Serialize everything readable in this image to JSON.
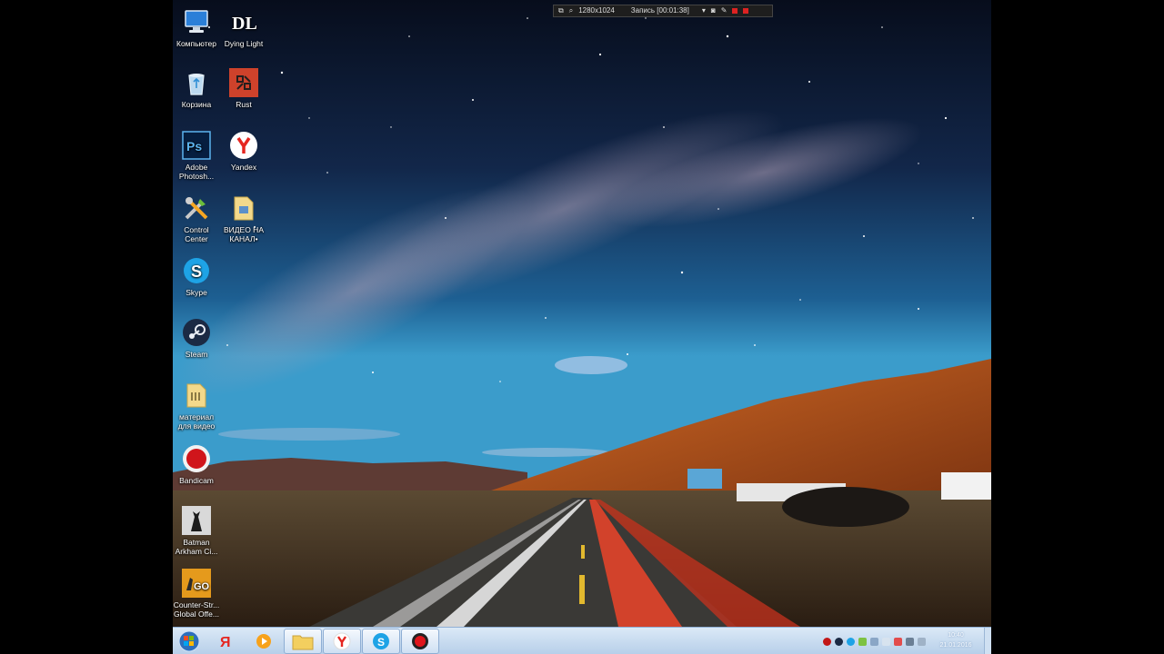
{
  "desktop_icons": [
    {
      "label": "Компьютер",
      "icon": "computer-icon"
    },
    {
      "label": "Dying Light",
      "icon": "dying-light-icon"
    },
    {
      "label": "Корзина",
      "icon": "recycle-bin-icon"
    },
    {
      "label": "Rust",
      "icon": "rust-icon"
    },
    {
      "label": "Adobe Photosh...",
      "icon": "photoshop-icon"
    },
    {
      "label": "Yandex",
      "icon": "yandex-browser-icon"
    },
    {
      "label": "Control Center",
      "icon": "control-center-icon"
    },
    {
      "label": "ВИДЕО НА КАНАЛ•",
      "icon": "folder-icon"
    },
    {
      "label": "Skype",
      "icon": "skype-icon"
    },
    {
      "label": "Steam",
      "icon": "steam-icon"
    },
    {
      "label": "материал для видео",
      "icon": "folder-icon"
    },
    {
      "label": "Bandicam",
      "icon": "bandicam-icon"
    },
    {
      "label": "Batman Arkham Ci...",
      "icon": "batman-icon"
    },
    {
      "label": "Counter-Str... Global Offe...",
      "icon": "csgo-icon"
    }
  ],
  "recorder_bar": {
    "resolution": "1280x1024",
    "status": "Запись [00:01:38]"
  },
  "taskbar": {
    "buttons": [
      {
        "icon": "windows-start-icon"
      },
      {
        "icon": "yandex-icon"
      },
      {
        "icon": "media-player-icon"
      },
      {
        "icon": "folder-icon"
      },
      {
        "icon": "yandex-browser-icon"
      },
      {
        "icon": "skype-icon"
      },
      {
        "icon": "bandicam-record-icon"
      }
    ],
    "clock_time": "10:40",
    "clock_date": "21.01.2016"
  },
  "colors": {
    "sky_top": "#0a1426",
    "sky_horizon": "#2e8ec2",
    "cliff": "#b9531d",
    "taskbar": "#c5daf0"
  }
}
